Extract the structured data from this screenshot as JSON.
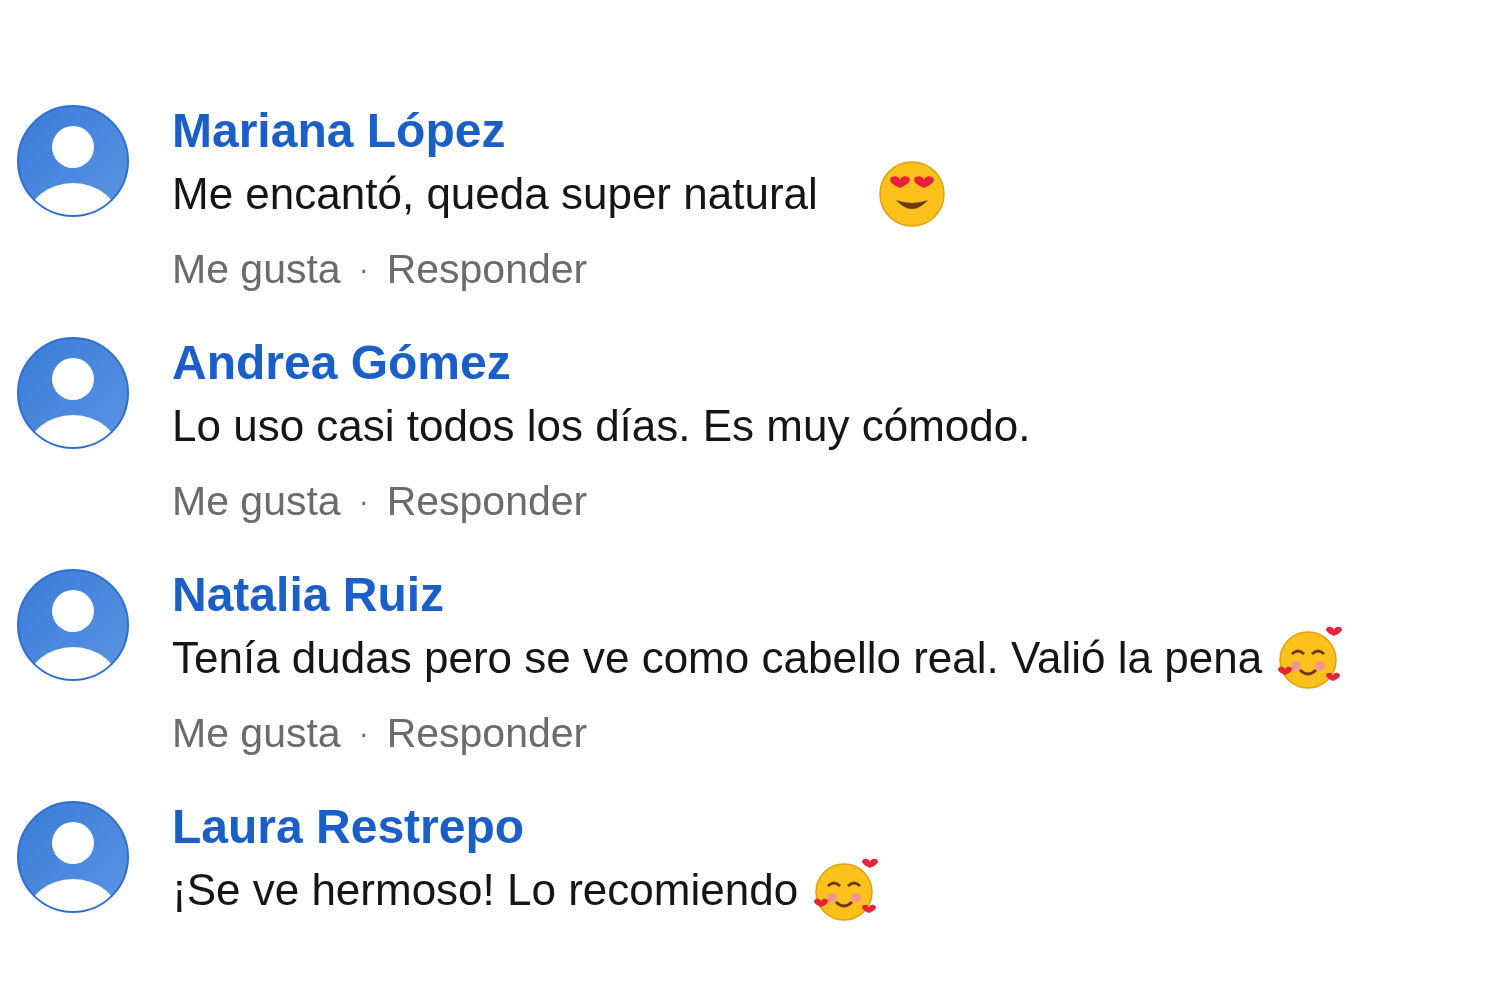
{
  "comments": [
    {
      "author": "Mariana López",
      "text": "Me encantó, queda super natural",
      "kind": "hearteyes",
      "actions": {
        "like": "Me gusta",
        "separator": "·",
        "reply": "Responder"
      }
    },
    {
      "author": "Andrea Gómez",
      "text": "Lo uso casi todos los días. Es muy cómodo.",
      "kind": "plain",
      "actions": {
        "like": "Me gusta",
        "separator": "·",
        "reply": "Responder"
      }
    },
    {
      "author": "Natalia Ruiz",
      "text": "Tenía dudas pero se ve como cabello real. Valió la pena",
      "kind": "hearts",
      "actions": {
        "like": "Me gusta",
        "separator": "·",
        "reply": "Responder"
      }
    },
    {
      "author": "Laura Restrepo",
      "text": "¡Se ve hermoso! Lo recomiendo",
      "kind": "hearts"
    }
  ]
}
